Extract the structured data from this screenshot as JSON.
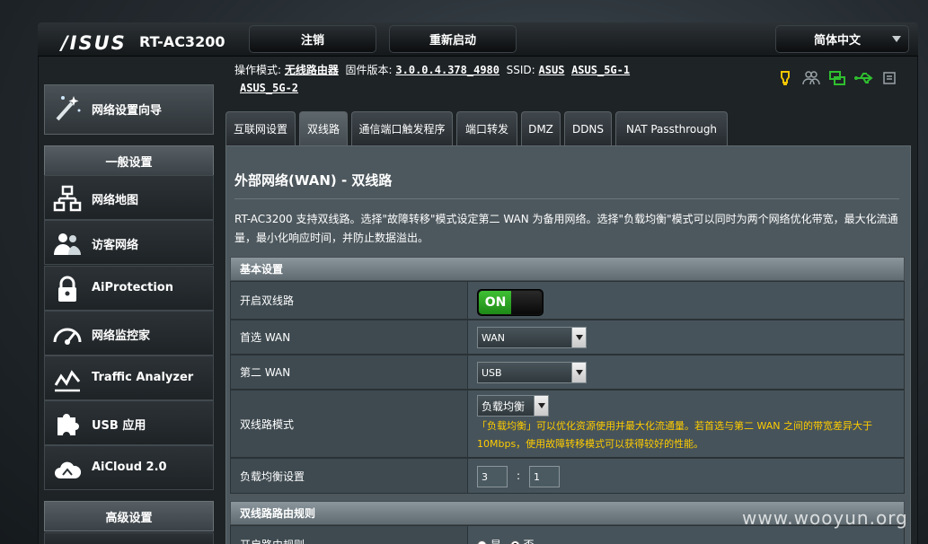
{
  "header": {
    "logo": "/ISUS",
    "model": "RT-AC3200",
    "logout_label": "注销",
    "reboot_label": "重新启动",
    "language": "简体中文"
  },
  "infobar": {
    "mode_label": "操作模式:",
    "mode_value": "无线路由器",
    "firmware_label": "固件版本:",
    "firmware_value": "3.0.0.4.378_4980",
    "ssid_label": "SSID:",
    "ssid_values": [
      "ASUS",
      "ASUS_5G-1",
      "ASUS_5G-2"
    ]
  },
  "sidebar": {
    "qis_label": "网络设置向导",
    "general_head": "一般设置",
    "items": [
      {
        "label": "网络地图",
        "icon": "network-map-icon"
      },
      {
        "label": "访客网络",
        "icon": "guest-network-icon"
      },
      {
        "label": "AiProtection",
        "icon": "lock-icon"
      },
      {
        "label": "网络监控家",
        "icon": "speedometer-icon"
      },
      {
        "label": "Traffic Analyzer",
        "icon": "traffic-chart-icon"
      },
      {
        "label": "USB 应用",
        "icon": "puzzle-icon"
      },
      {
        "label": "AiCloud 2.0",
        "icon": "cloud-icon"
      }
    ],
    "advanced_head": "高级设置"
  },
  "tabs": [
    "互联网设置",
    "双线路",
    "通信端口触发程序",
    "端口转发",
    "DMZ",
    "DDNS",
    "NAT Passthrough"
  ],
  "page": {
    "title": "外部网络(WAN) - 双线路",
    "description": "RT-AC3200 支持双线路。选择\"故障转移\"模式设定第二 WAN 为备用网络。选择\"负载均衡\"模式可以同时为两个网络优化带宽，最大化流通量，最小化响应时间，并防止数据溢出。"
  },
  "basic": {
    "head": "基本设置",
    "enable_label": "开启双线路",
    "enable_value": "ON",
    "primary_label": "首选 WAN",
    "primary_value": "WAN",
    "secondary_label": "第二 WAN",
    "secondary_value": "USB",
    "mode_label": "双线路模式",
    "mode_value": "负载均衡",
    "mode_hint": "「负载均衡」可以优化资源使用并最大化流通量。若首选与第二 WAN 之间的带宽差异大于 10Mbps，使用故障转移模式可以获得较好的性能。",
    "ratio_label": "负载均衡设置",
    "ratio_a": "3",
    "ratio_sep": ":",
    "ratio_b": "1"
  },
  "routing": {
    "head": "双线路路由规则",
    "enable_label": "开启路由规则",
    "opt_yes": "是",
    "opt_no": "否"
  },
  "watermark": "www.wooyun.org",
  "colors": {
    "accent_on": "#2fa626",
    "hint": "#ffcc00"
  }
}
